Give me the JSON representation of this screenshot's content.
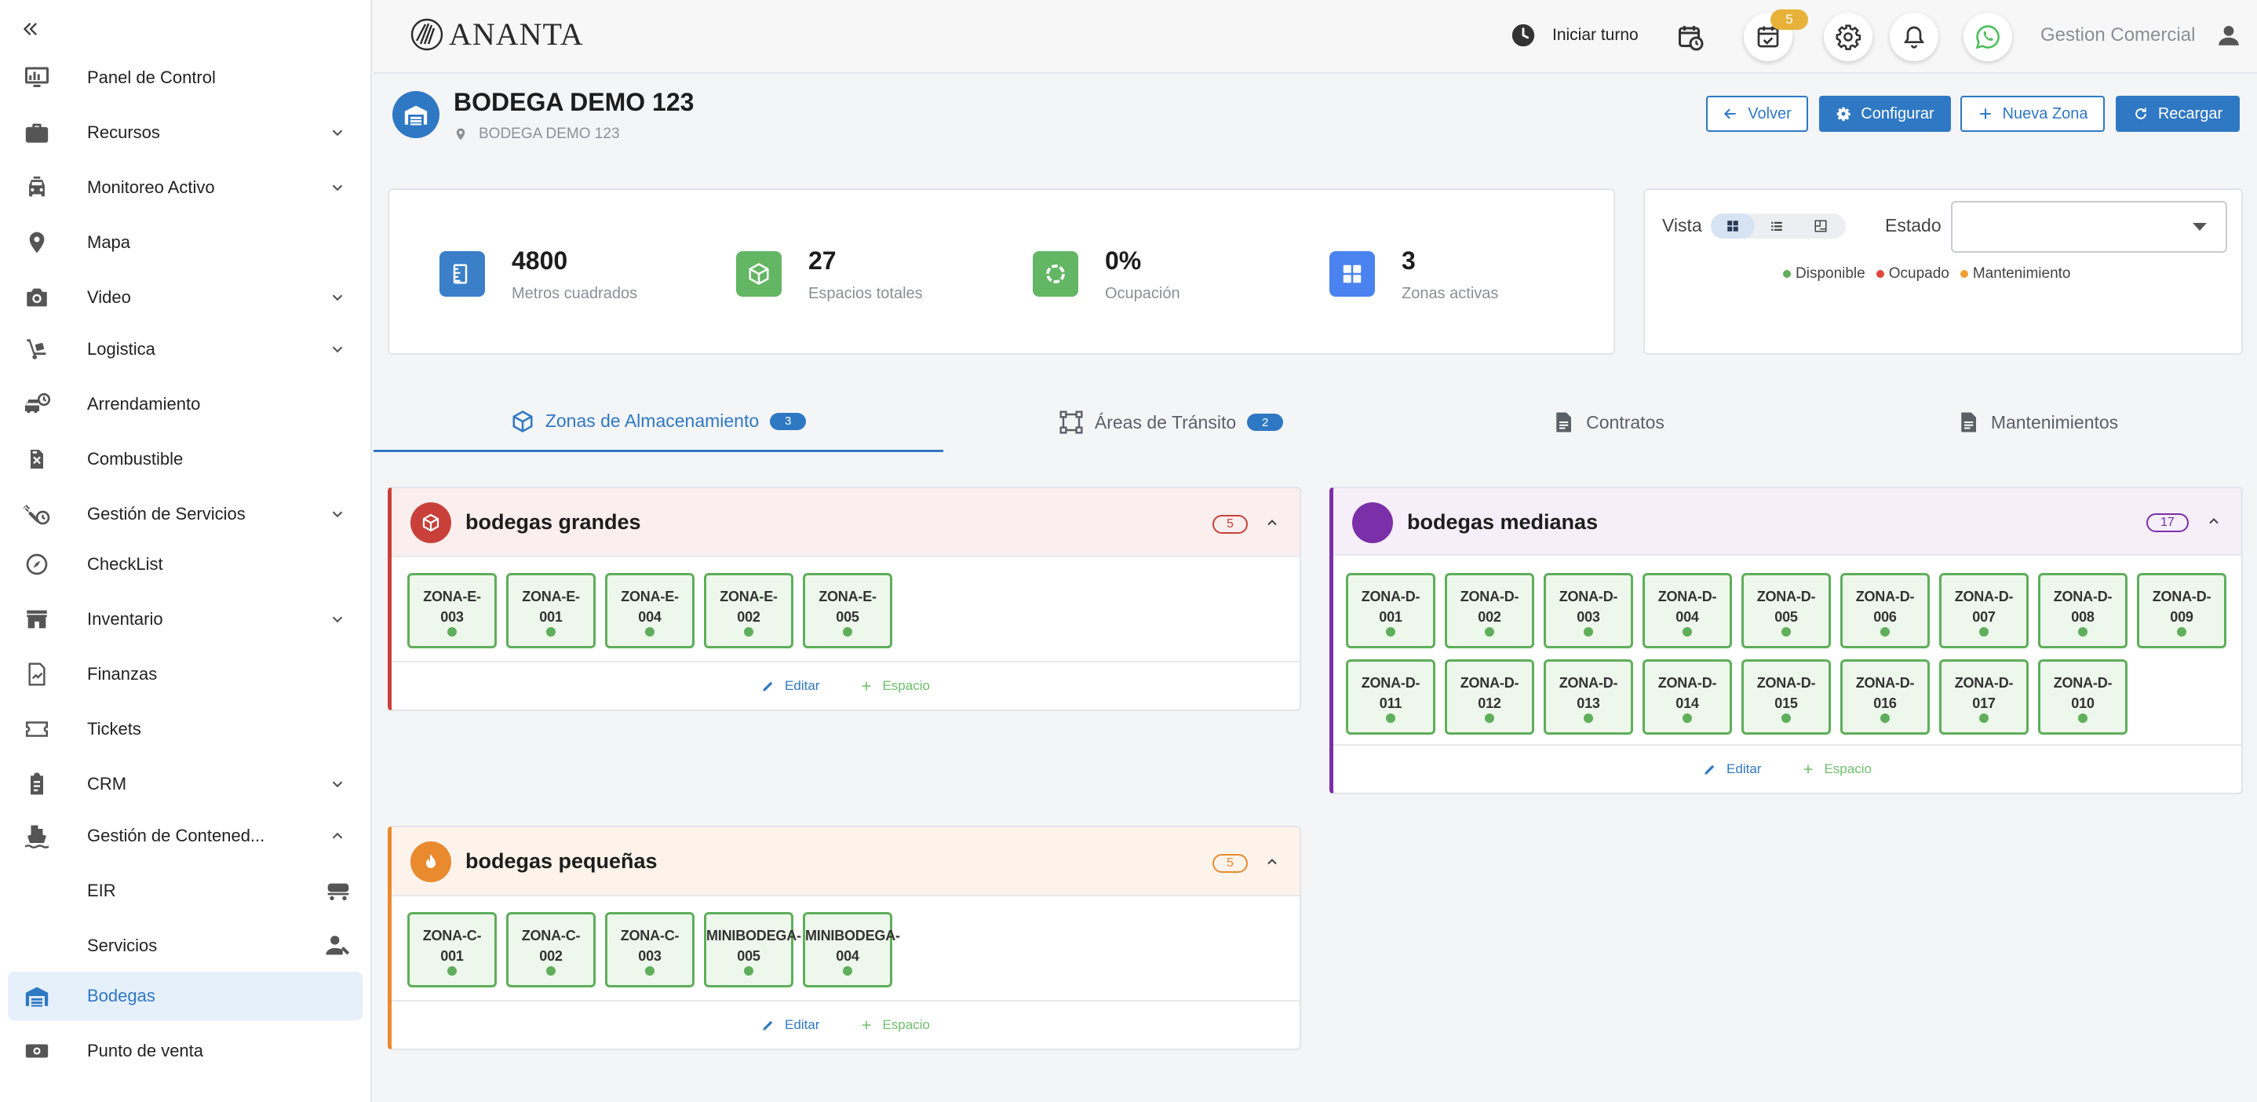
{
  "sidebar": {
    "items": [
      {
        "label": "Panel de Control"
      },
      {
        "label": "Recursos"
      },
      {
        "label": "Monitoreo Activo"
      },
      {
        "label": "Mapa"
      },
      {
        "label": "Video"
      },
      {
        "label": "Logistica"
      },
      {
        "label": "Arrendamiento"
      },
      {
        "label": "Combustible"
      },
      {
        "label": "Gestión de Servicios"
      },
      {
        "label": "CheckList"
      },
      {
        "label": "Inventario"
      },
      {
        "label": "Finanzas"
      },
      {
        "label": "Tickets"
      },
      {
        "label": "CRM"
      },
      {
        "label": "Gestión de Contened..."
      },
      {
        "label": "EIR"
      },
      {
        "label": "Servicios"
      },
      {
        "label": "Bodegas"
      },
      {
        "label": "Punto de venta"
      }
    ],
    "active": "Bodegas"
  },
  "topbar": {
    "logo_text": "ANANTA",
    "shift_label": "Iniciar turno",
    "tasks_badge": "5",
    "user_name": "Gestion Comercial"
  },
  "page": {
    "title": "BODEGA DEMO 123",
    "subtitle": "BODEGA DEMO 123",
    "buttons": {
      "back": "Volver",
      "configure": "Configurar",
      "new_zone": "Nueva Zona",
      "reload": "Recargar"
    }
  },
  "stats": [
    {
      "value": "4800",
      "label": "Metros cuadrados",
      "color": "#3b7fc9",
      "icon": "ruler-icon"
    },
    {
      "value": "27",
      "label": "Espacios totales",
      "color": "#63b663",
      "icon": "cube-icon"
    },
    {
      "value": "0%",
      "label": "Ocupación",
      "color": "#63b663",
      "icon": "progress-ring-icon"
    },
    {
      "value": "3",
      "label": "Zonas activas",
      "color": "#4a82f0",
      "icon": "grid-icon"
    }
  ],
  "filters": {
    "vista_label": "Vista",
    "estado_label": "Estado",
    "estado_value": "",
    "legend": [
      {
        "label": "Disponible",
        "color": "#5fae5b"
      },
      {
        "label": "Ocupado",
        "color": "#e0453a"
      },
      {
        "label": "Mantenimiento",
        "color": "#f0a030"
      }
    ]
  },
  "tabs": [
    {
      "label": "Zonas de Almacenamiento",
      "badge": "3",
      "active": true
    },
    {
      "label": "Áreas de Tránsito",
      "badge": "2",
      "active": false
    },
    {
      "label": "Contratos",
      "badge": "",
      "active": false
    },
    {
      "label": "Mantenimientos",
      "badge": "",
      "active": false
    }
  ],
  "zones": [
    {
      "name": "bodegas grandes",
      "count": "5",
      "accent": "#c9403a",
      "head_bg": "#fbeeee",
      "spaces": [
        "ZONA-E-\n003",
        "ZONA-E-\n001",
        "ZONA-E-\n004",
        "ZONA-E-\n002",
        "ZONA-E-\n005"
      ]
    },
    {
      "name": "bodegas medianas",
      "count": "17",
      "accent": "#7b2fa8",
      "head_bg": "#f6eef9",
      "spaces": [
        "ZONA-D-\n001",
        "ZONA-D-\n002",
        "ZONA-D-\n003",
        "ZONA-D-\n004",
        "ZONA-D-\n005",
        "ZONA-D-\n006",
        "ZONA-D-\n007",
        "ZONA-D-\n008",
        "ZONA-D-\n009",
        "ZONA-D-\n011",
        "ZONA-D-\n012",
        "ZONA-D-\n013",
        "ZONA-D-\n014",
        "ZONA-D-\n015",
        "ZONA-D-\n016",
        "ZONA-D-\n017",
        "ZONA-D-\n010"
      ]
    },
    {
      "name": "bodegas pequeñas",
      "count": "5",
      "accent": "#e98a2e",
      "head_bg": "#fdf3ea",
      "spaces": [
        "ZONA-C-\n001",
        "ZONA-C-\n002",
        "ZONA-C-\n003",
        "MINIBODEGA-\n005",
        "MINIBODEGA-\n004"
      ]
    }
  ],
  "zone_actions": {
    "edit": "Editar",
    "add_space": "Espacio"
  }
}
